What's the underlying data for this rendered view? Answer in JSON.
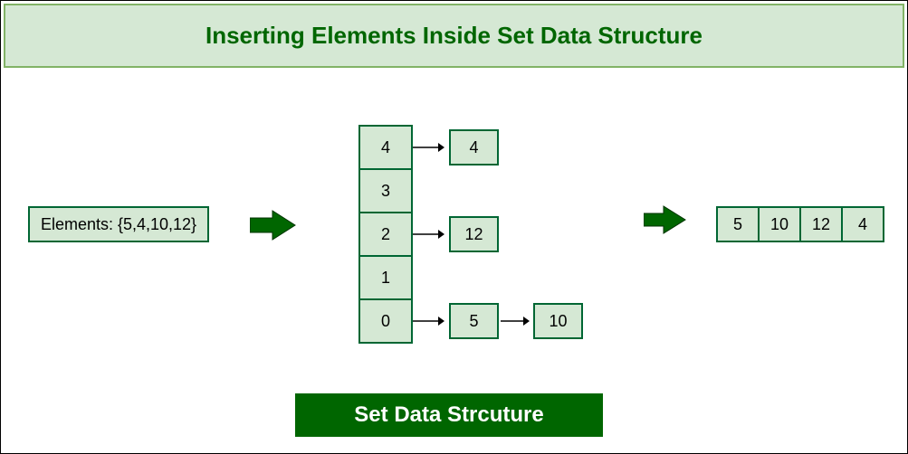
{
  "title": "Inserting Elements Inside Set Data Structure",
  "elements_label": "Elements: {5,4,10,12}",
  "buckets": [
    "4",
    "3",
    "2",
    "1",
    "0"
  ],
  "chain_bucket4": "4",
  "chain_bucket2": "12",
  "chain_bucket0_a": "5",
  "chain_bucket0_b": "10",
  "result": [
    "5",
    "10",
    "12",
    "4"
  ],
  "footer": "Set Data Strcuture"
}
